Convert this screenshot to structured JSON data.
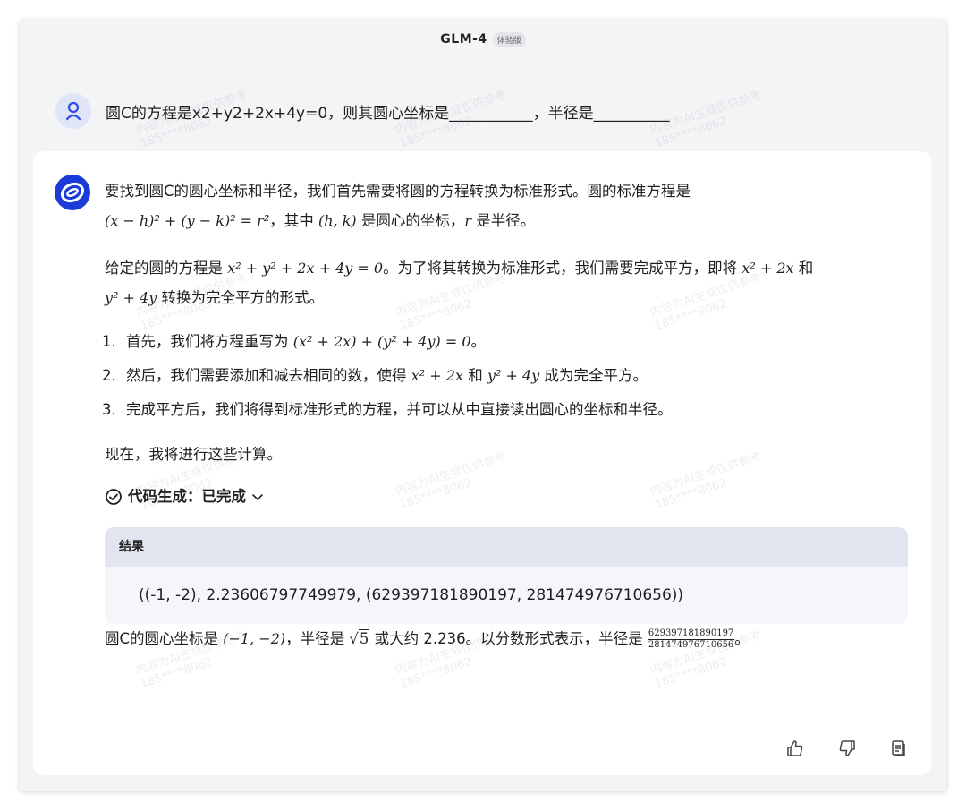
{
  "header": {
    "title": "GLM-4",
    "badge": "体验版"
  },
  "user_message": "圆C的方程是x2+y2+2x+4y=0，则其圆心坐标是___________，半径是__________",
  "answer": {
    "p1_a": "要找到圆C的圆心坐标和半径，我们首先需要将圆的方程转换为标准形式。圆的标准方程是",
    "p1_math": "(x − h)² + (y − k)² = r²",
    "p1_b": "，其中",
    "p1_hk": "(h, k)",
    "p1_c": "是圆心的坐标，",
    "p1_r": "r",
    "p1_d": "是半径。",
    "p2_a": "给定的圆的方程是",
    "p2_math1": "x² + y² + 2x + 4y = 0",
    "p2_b": "。为了将其转换为标准形式，我们需要完成平方，即将",
    "p2_math2": "x² + 2x",
    "p2_c": "和",
    "p2_math3": "y² + 4y",
    "p2_d": "转换为完全平方的形式。",
    "steps": [
      {
        "a": "首先，我们将方程重写为",
        "m": "(x² + 2x) + (y² + 4y) = 0",
        "b": "。"
      },
      {
        "a": "然后，我们需要添加和减去相同的数，使得",
        "m": "x² + 2x",
        "c": "和",
        "m2": "y² + 4y",
        "b": "成为完全平方。"
      },
      {
        "a": "完成平方后，我们将得到标准形式的方程，并可以从中直接读出圆心的坐标和半径。"
      }
    ],
    "p3": "现在，我将进行这些计算。",
    "code_status": "代码生成：已完成",
    "result_label": "结果",
    "result_value": "((-1, -2), 2.23606797749979, (629397181890197, 281474976710656))",
    "final_a": "圆C的圆心坐标是",
    "final_center": "(−1, −2)",
    "final_b": "，半径是",
    "final_sqrt": "5",
    "final_c": "或大约 2.236。以分数形式表示，半径是",
    "final_num": "629397181890197",
    "final_den": "281474976710656",
    "final_d": "。"
  },
  "watermark": {
    "line1": "内容为AI生成仅供参考",
    "line2": "185****8062"
  },
  "colors": {
    "accent": "#1a3bd8",
    "avatar_user_bg": "#dfe4f7",
    "result_head_bg": "#e2e5f0"
  },
  "icons": [
    "user-icon",
    "glm-logo-icon",
    "check-circle-icon",
    "chevron-down-icon",
    "thumbs-up-icon",
    "thumbs-down-icon",
    "copy-icon"
  ]
}
